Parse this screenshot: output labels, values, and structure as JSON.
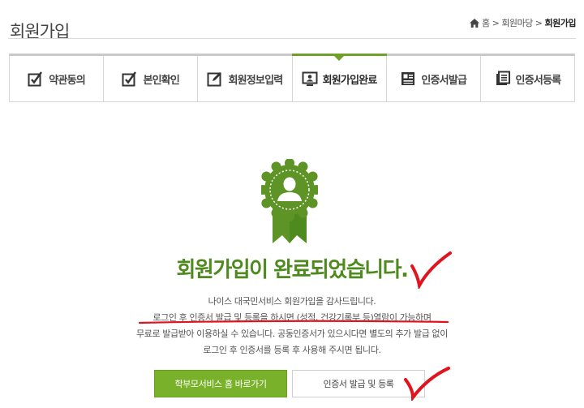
{
  "page": {
    "title": "회원가입"
  },
  "breadcrumb": {
    "home": "홈",
    "sep": ">",
    "parent": "회원마당",
    "current": "회원가입"
  },
  "steps": [
    {
      "label": "약관동의",
      "icon": "checkbox-pen-icon",
      "active": false
    },
    {
      "label": "본인확인",
      "icon": "checkbox-pen-icon",
      "active": false
    },
    {
      "label": "회원정보입력",
      "icon": "edit-pen-icon",
      "active": false
    },
    {
      "label": "회원가입완료",
      "icon": "user-monitor-icon",
      "active": true
    },
    {
      "label": "인증서발급",
      "icon": "certificate-document-icon",
      "active": false
    },
    {
      "label": "인증서등록",
      "icon": "certificate-register-icon",
      "active": false
    }
  ],
  "main": {
    "headline": "회원가입이 완료되었습니다.",
    "desc_lines": [
      "나이스 대국민서비스 회원가입을 감사드립니다.",
      "로그인 후 인증서 발급 및 등록을 하시면 (성적, 건강기록부 등)열람이 가능하며",
      "무료로 발급받아 이용하실 수 있습니다. 공동인증서가 있으시다면 별도의 추가 발급 없이",
      "로그인 후 인증서를 등록 후 사용해 주시면 됩니다."
    ]
  },
  "buttons": {
    "primary": "학부모서비스 홈 바로가기",
    "secondary": "인증서 발급 및 등록"
  },
  "colors": {
    "accent": "#79b12a",
    "headline": "#4f8a1f",
    "annotation": "#e0141e"
  }
}
